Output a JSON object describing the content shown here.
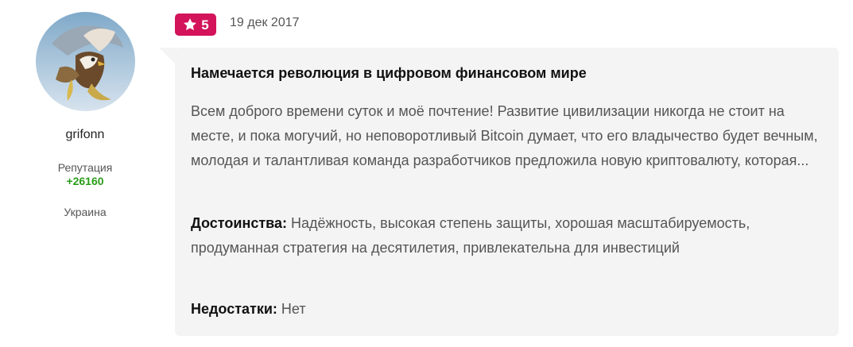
{
  "author": {
    "username": "grifonn",
    "reputation_label": "Репутация",
    "reputation_value": "+26160",
    "country": "Украина"
  },
  "review": {
    "rating": "5",
    "rating_icon": "star-icon",
    "date": "19 дек 2017",
    "title": "Намечается революция в цифровом финансовом мире",
    "text": "Всем доброго времени суток и моё почтение! Развитие цивилизации никогда не стоит на месте, и пока могучий, но неповоротливый Bitcoin думает, что его владычество будет вечным, молодая и талантливая команда разработчиков предложила новую криптовалюту, которая...",
    "pros_label": "Достоинства:",
    "pros_text": " Надёжность, высокая степень защиты, хорошая масштабируемость, продуманная стратегия на десятилетия, привлекательна для инвестиций",
    "cons_label": "Недостатки:",
    "cons_text": " Нет"
  },
  "colors": {
    "badge": "#d3145a",
    "reputation": "#2a9d1a",
    "card_bg": "#f4f4f5"
  }
}
